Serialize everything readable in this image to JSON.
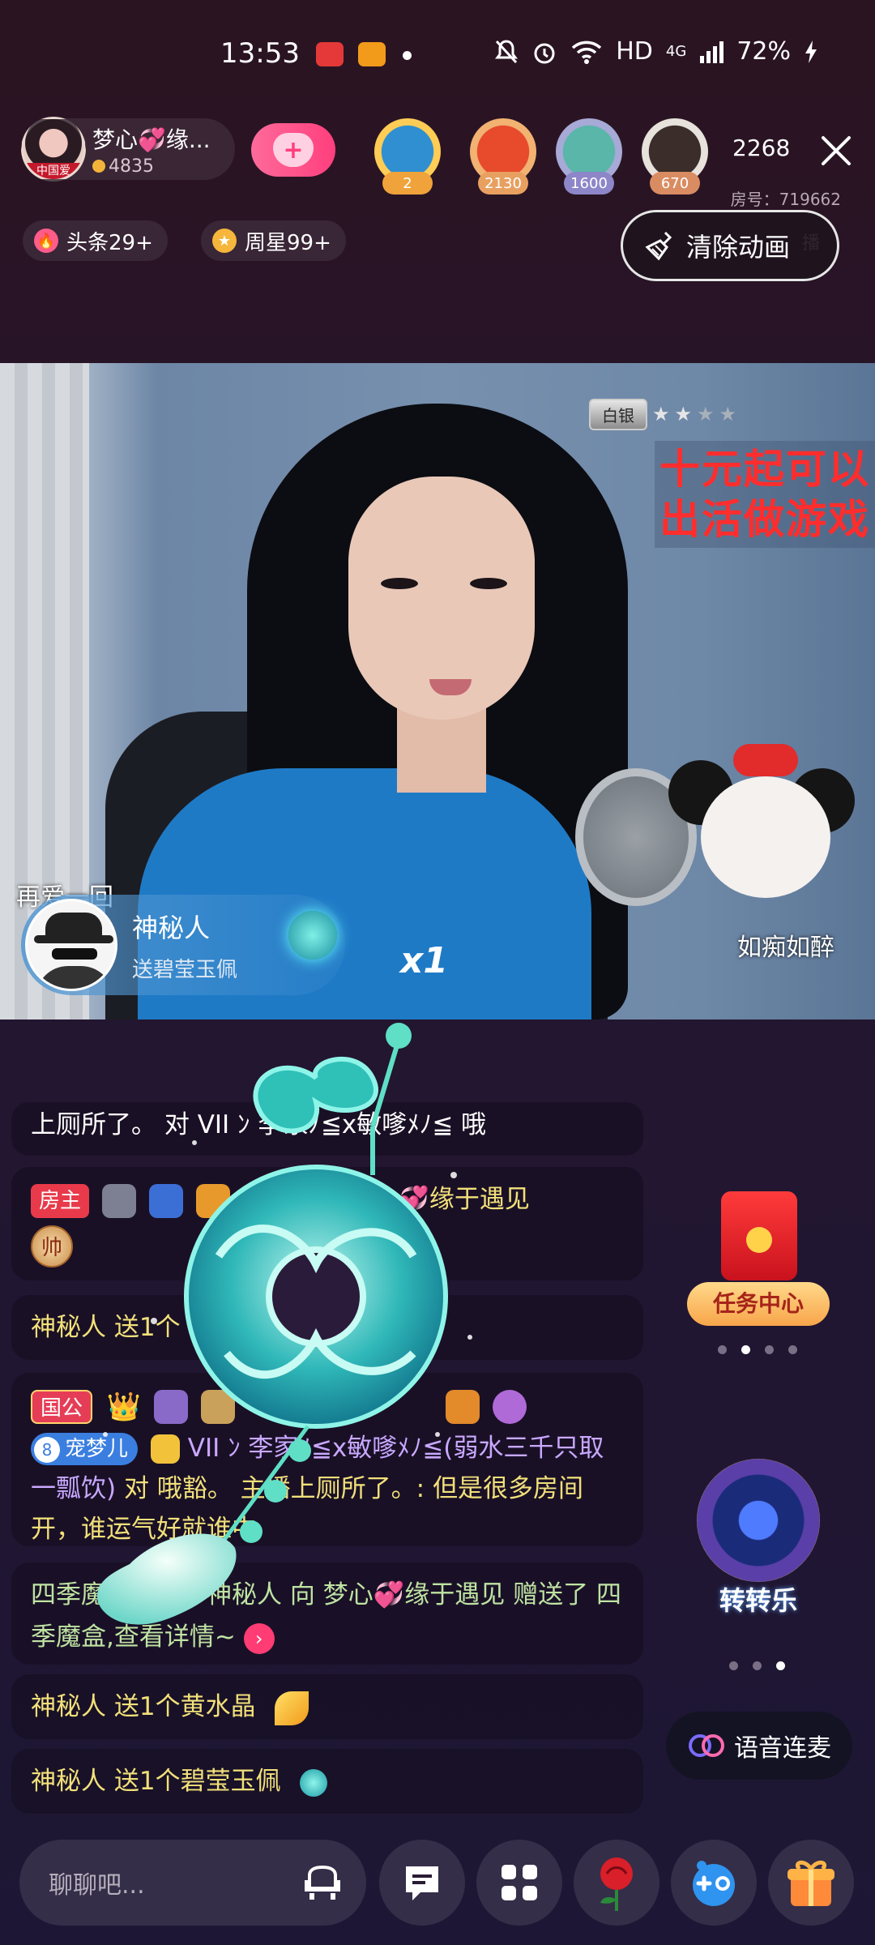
{
  "status_bar": {
    "time": "13:53",
    "network": "HD",
    "signal": "4G",
    "battery": "72%"
  },
  "host": {
    "name": "梦心💞缘...",
    "fans": "4835",
    "avatar_tag": "中国爱"
  },
  "top_viewers": [
    {
      "badge": "2",
      "color": "#f0a33a",
      "ring": "#ffcc55"
    },
    {
      "badge": "2130",
      "color": "#e8a060",
      "ring": "#f2b272"
    },
    {
      "badge": "1600",
      "color": "#8d86c9",
      "ring": "#a7a9d6"
    },
    {
      "badge": "670",
      "color": "#d98c62",
      "ring": "#d9b08a"
    }
  ],
  "viewer_count": "2268",
  "room_number": "房号：719662",
  "pills": {
    "headline": "头条29+",
    "weekly_star": "周星99+"
  },
  "clear_button": "清除动画",
  "clear_behind_text": "播",
  "video": {
    "rank_label": "白银",
    "promo_line1": "十元起可以",
    "promo_line2": "出活做游戏",
    "overlay_left": "再爱一回",
    "overlay_right": "如痴如醉"
  },
  "gift_banner": {
    "sender": "神秘人",
    "description": "送碧莹玉佩",
    "count": "x1"
  },
  "chat": {
    "msg1": "上厕所了。 对 VII ﾝ 李家ﾉ≦x敏嗲ﾒﾉ≦ 哦",
    "msg2_badge": "房主",
    "msg2_text": "💞缘于遇见",
    "msg2_shuai": "帅",
    "msg3_user": "神秘人",
    "msg3_text": " 送1个",
    "msg4_badge": "国公",
    "msg4_pet_num": "8",
    "msg4_pet": "宠梦儿",
    "msg4_user": "VII ﾝ 李家ﾉ≦x敏嗲ﾒﾉ≦(弱水三千只取一瓢饮)",
    "msg4_text": " 对 哦豁。 主播上厕所了。: 但是很多房间开，谁运气好就谁中",
    "msg5_text": "四季魔盒消息：神秘人 向 梦心💞缘于遇见 赠送了 四季魔盒,查看详情~",
    "msg6_user": "神秘人",
    "msg6_text": " 送1个黄水晶",
    "msg7_user": "神秘人",
    "msg7_text": " 送1个碧莹玉佩"
  },
  "side": {
    "task_center": "任务中心",
    "spin_game": "转转乐",
    "voice_link": "语音连麦"
  },
  "bottom": {
    "chat_placeholder": "聊聊吧..."
  },
  "colors": {
    "accent_pink": "#ff3f7d",
    "chat_yellow": "#f2e07a",
    "promo_red": "#ff2d2d"
  }
}
